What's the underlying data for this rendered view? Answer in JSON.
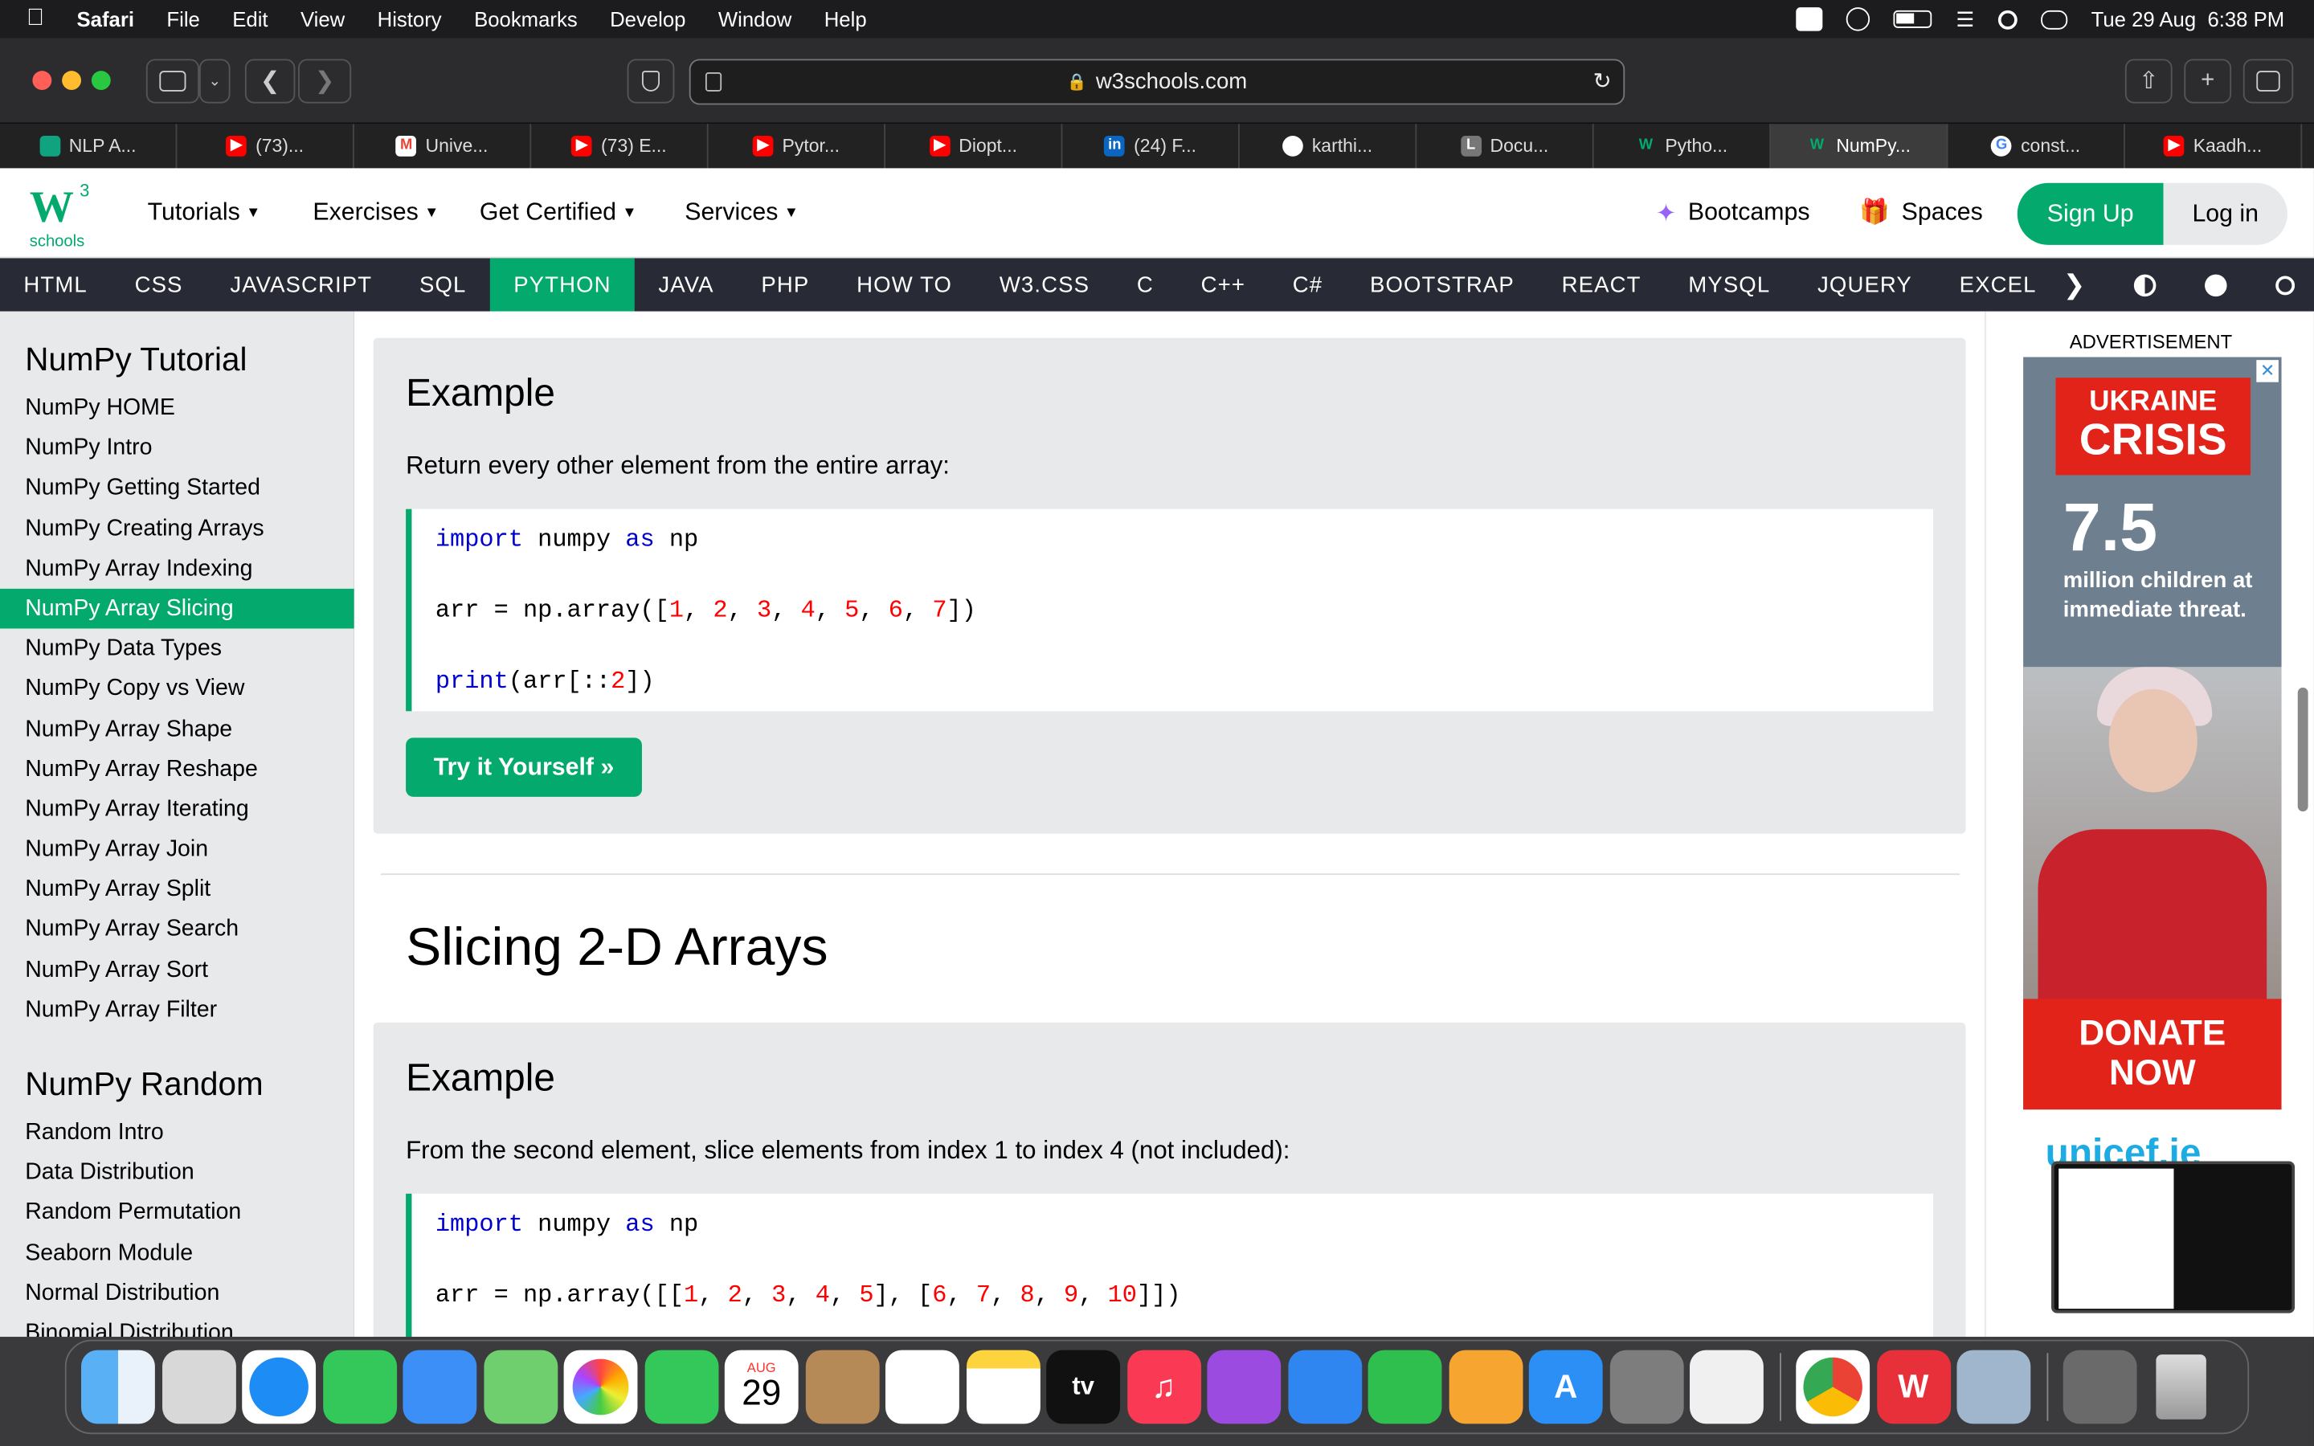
{
  "menubar": {
    "apple": "",
    "app": "Safari",
    "items": [
      "File",
      "Edit",
      "View",
      "History",
      "Bookmarks",
      "Develop",
      "Window",
      "Help"
    ],
    "datetime": "Tue 29 Aug  6:38 PM"
  },
  "toolbar": {
    "url": "w3schools.com"
  },
  "tabs": [
    {
      "label": "NLP A...",
      "color": "#10a37f"
    },
    {
      "label": "(73)...",
      "color": "#ff0000"
    },
    {
      "label": "Unive...",
      "color": "#ea4335"
    },
    {
      "label": "(73) E...",
      "color": "#ff0000"
    },
    {
      "label": "Pytor...",
      "color": "#ff0000"
    },
    {
      "label": "Diopt...",
      "color": "#ff0000"
    },
    {
      "label": "(24) F...",
      "color": "#0a66c2"
    },
    {
      "label": "karthi...",
      "color": "#ffffff"
    },
    {
      "label": "Docu...",
      "color": "#777777"
    },
    {
      "label": "Pytho...",
      "color": "#04AA6D"
    },
    {
      "label": "NumPy...",
      "color": "#04AA6D",
      "active": true
    },
    {
      "label": "const...",
      "color": "#4285f4"
    },
    {
      "label": "Kaadh...",
      "color": "#ff0000"
    }
  ],
  "w3nav": {
    "logo_text": "schools",
    "logo_sup": "3",
    "logo_w": "W",
    "tutorials": "Tutorials",
    "exercises": "Exercises",
    "certified": "Get Certified",
    "services": "Services",
    "bootcamps": "Bootcamps",
    "spaces": "Spaces",
    "signup": "Sign Up",
    "login": "Log in"
  },
  "langnav": [
    "HTML",
    "CSS",
    "JAVASCRIPT",
    "SQL",
    "PYTHON",
    "JAVA",
    "PHP",
    "HOW TO",
    "W3.CSS",
    "C",
    "C++",
    "C#",
    "BOOTSTRAP",
    "REACT",
    "MYSQL",
    "JQUERY",
    "EXCEL"
  ],
  "sidebar": {
    "heading1": "NumPy Tutorial",
    "items1": [
      "NumPy HOME",
      "NumPy Intro",
      "NumPy Getting Started",
      "NumPy Creating Arrays",
      "NumPy Array Indexing",
      "NumPy Array Slicing",
      "NumPy Data Types",
      "NumPy Copy vs View",
      "NumPy Array Shape",
      "NumPy Array Reshape",
      "NumPy Array Iterating",
      "NumPy Array Join",
      "NumPy Array Split",
      "NumPy Array Search",
      "NumPy Array Sort",
      "NumPy Array Filter"
    ],
    "heading2": "NumPy Random",
    "items2": [
      "Random Intro",
      "Data Distribution",
      "Random Permutation",
      "Seaborn Module",
      "Normal Distribution",
      "Binomial Distribution"
    ]
  },
  "main": {
    "ex1_title": "Example",
    "ex1_desc": "Return every other element from the entire array:",
    "try_label": "Try it Yourself »",
    "h2": "Slicing 2-D Arrays",
    "ex2_title": "Example",
    "ex2_desc": "From the second element, slice elements from index 1 to index 4 (not included):"
  },
  "ad": {
    "label": "ADVERTISEMENT",
    "line1": "UKRAINE",
    "line2": "CRISIS",
    "number": "7.5",
    "text": "million children at immediate threat.",
    "donate1": "DONATE",
    "donate2": "NOW",
    "unicef": "unicef.ie"
  },
  "dock": {
    "calendar_month": "AUG",
    "calendar_day": "29",
    "tv": "tv"
  }
}
